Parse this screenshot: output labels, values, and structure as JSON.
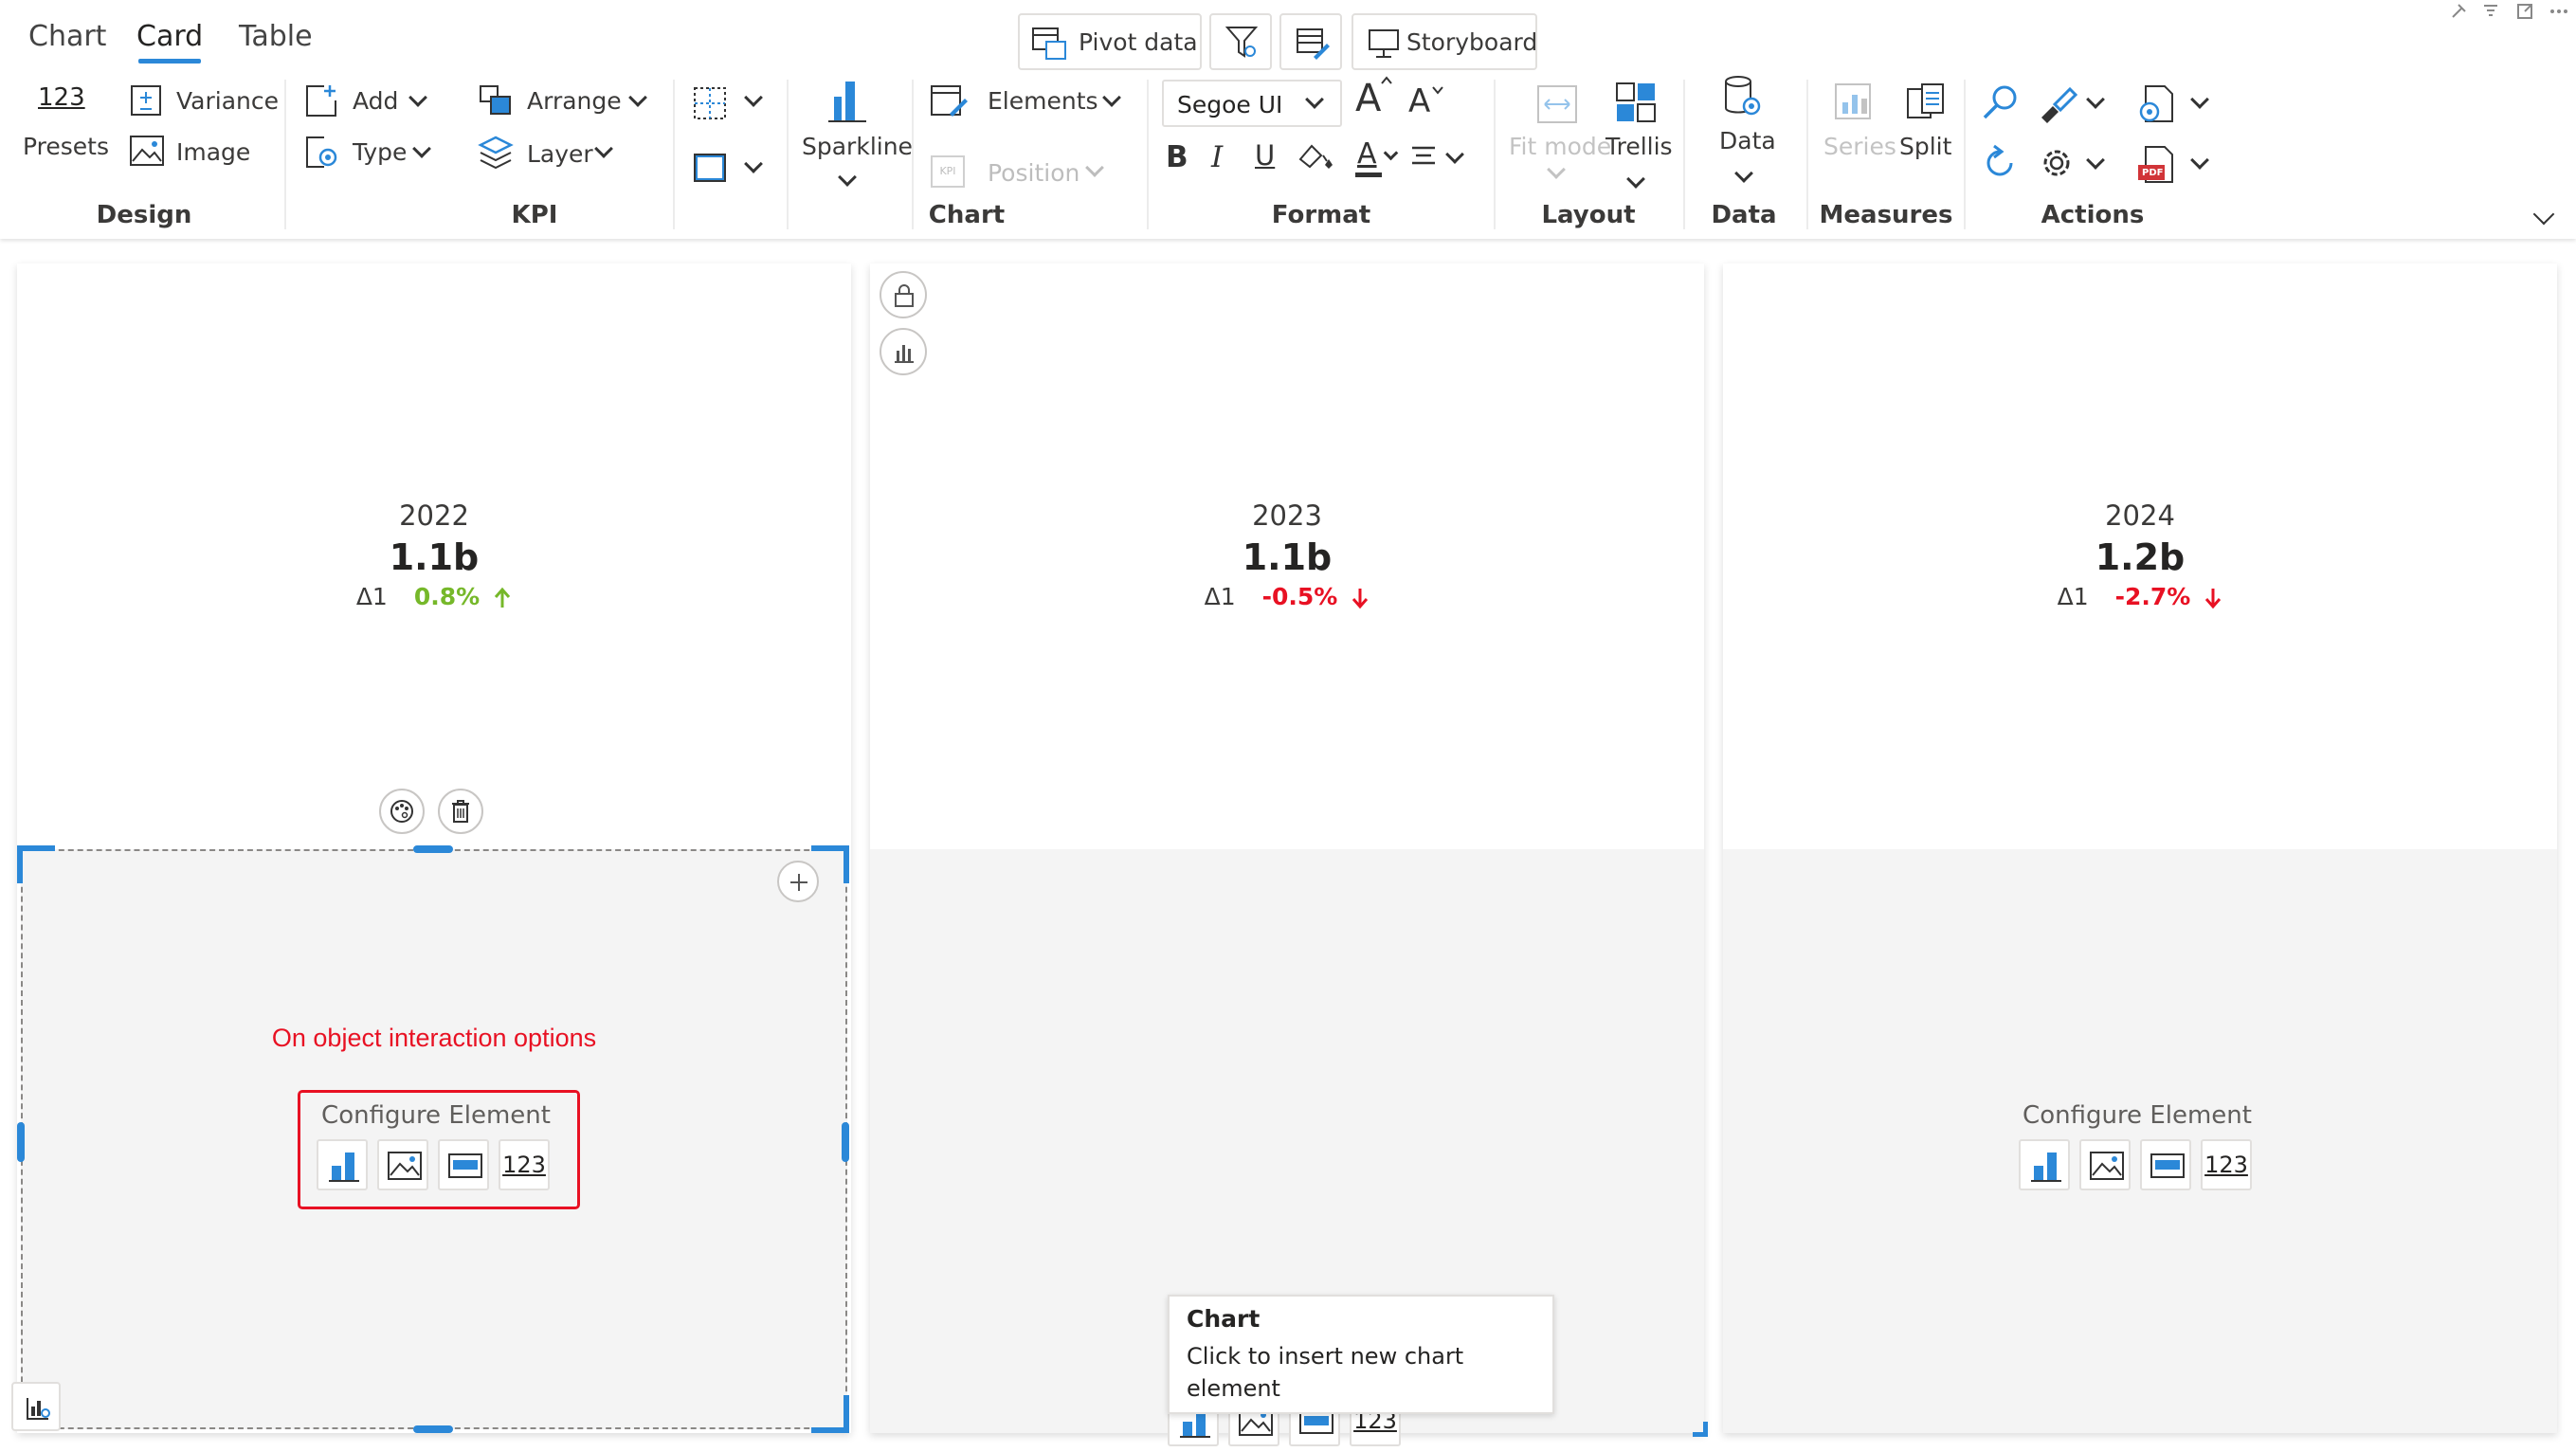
{
  "tabs": [
    {
      "label": "Chart"
    },
    {
      "label": "Card"
    },
    {
      "label": "Table"
    }
  ],
  "topbar": {
    "pivot_label": "Pivot data",
    "storyboard_label": "Storyboard"
  },
  "ribbon": {
    "presets_num": "123",
    "presets_label": "Presets",
    "variance_label": "Variance",
    "image_label": "Image",
    "add_label": "Add",
    "type_label": "Type",
    "arrange_label": "Arrange",
    "layer_label": "Layer",
    "sparkline_label": "Sparkline",
    "elements_label": "Elements",
    "kpi_small": "KPI",
    "position_label": "Position",
    "font_name": "Segoe UI",
    "bold": "B",
    "italic": "I",
    "underline": "U",
    "font_color_glyph": "A",
    "grow_glyph": "A",
    "shrink_glyph": "A",
    "fitmode_label": "Fit mode",
    "trellis_label": "Trellis",
    "data_label": "Data",
    "series_label": "Series",
    "split_label": "Split",
    "pdf_badge": "PDF",
    "groups": {
      "design": "Design",
      "kpi": "KPI",
      "chart": "Chart",
      "format": "Format",
      "layout": "Layout",
      "data": "Data",
      "measures": "Measures",
      "actions": "Actions"
    }
  },
  "cards": [
    {
      "year": "2022",
      "value": "1.1b",
      "delta_label": "Δ1",
      "delta_pct": "0.8%",
      "trend": "up"
    },
    {
      "year": "2023",
      "value": "1.1b",
      "delta_label": "Δ1",
      "delta_pct": "-0.5%",
      "trend": "down"
    },
    {
      "year": "2024",
      "value": "1.2b",
      "delta_label": "Δ1",
      "delta_pct": "-2.7%",
      "trend": "down"
    }
  ],
  "annotation": {
    "text": "On object interaction options"
  },
  "configure": {
    "title": "Configure Element",
    "kpi_num": "123"
  },
  "tooltip": {
    "title": "Chart",
    "line1": "Click to insert new chart",
    "line2": "element"
  },
  "colors": {
    "accent": "#2b88d8",
    "positive": "#76b82a",
    "negative": "#e81123",
    "annotation": "#e81123"
  }
}
